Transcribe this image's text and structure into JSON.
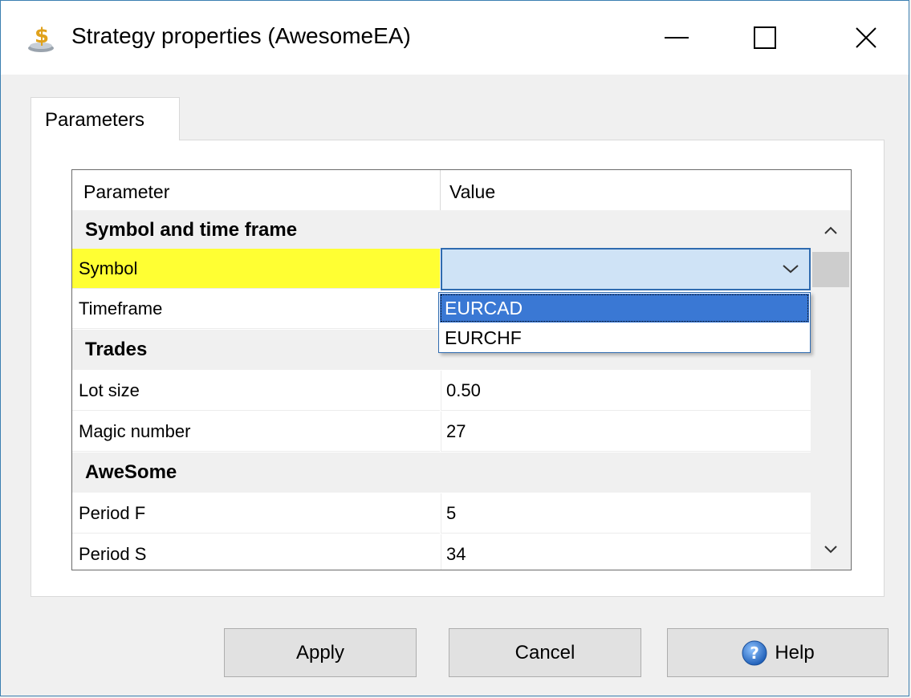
{
  "window": {
    "title": "Strategy properties (AwesomeEA)",
    "icon": "strategy-dollar-icon",
    "controls": [
      "minimize-icon",
      "maximize-icon",
      "close-icon"
    ]
  },
  "tabs": [
    {
      "label": "Parameters",
      "active": true
    }
  ],
  "grid": {
    "headers": {
      "parameter": "Parameter",
      "value": "Value"
    },
    "rows": [
      {
        "type": "section",
        "label": "Symbol and time frame"
      },
      {
        "type": "param",
        "label": "Symbol",
        "value": "",
        "highlighted": true,
        "editor": "combobox"
      },
      {
        "type": "param",
        "label": "Timeframe",
        "value": ""
      },
      {
        "type": "section",
        "label": "Trades"
      },
      {
        "type": "param",
        "label": "Lot size",
        "value": "0.50"
      },
      {
        "type": "param",
        "label": "Magic number",
        "value": "27"
      },
      {
        "type": "section",
        "label": "AweSome"
      },
      {
        "type": "param",
        "label": "Period F",
        "value": "5"
      },
      {
        "type": "param",
        "label": "Period S",
        "value": "34"
      }
    ]
  },
  "dropdown": {
    "options": [
      "EURCAD",
      "EURCHF"
    ],
    "selected": "EURCAD"
  },
  "buttons": {
    "apply": "Apply",
    "cancel": "Cancel",
    "help": "Help"
  },
  "colors": {
    "highlight": "#ffff33",
    "selection": "#3a78d4",
    "combo_bg": "#cfe3f6"
  }
}
